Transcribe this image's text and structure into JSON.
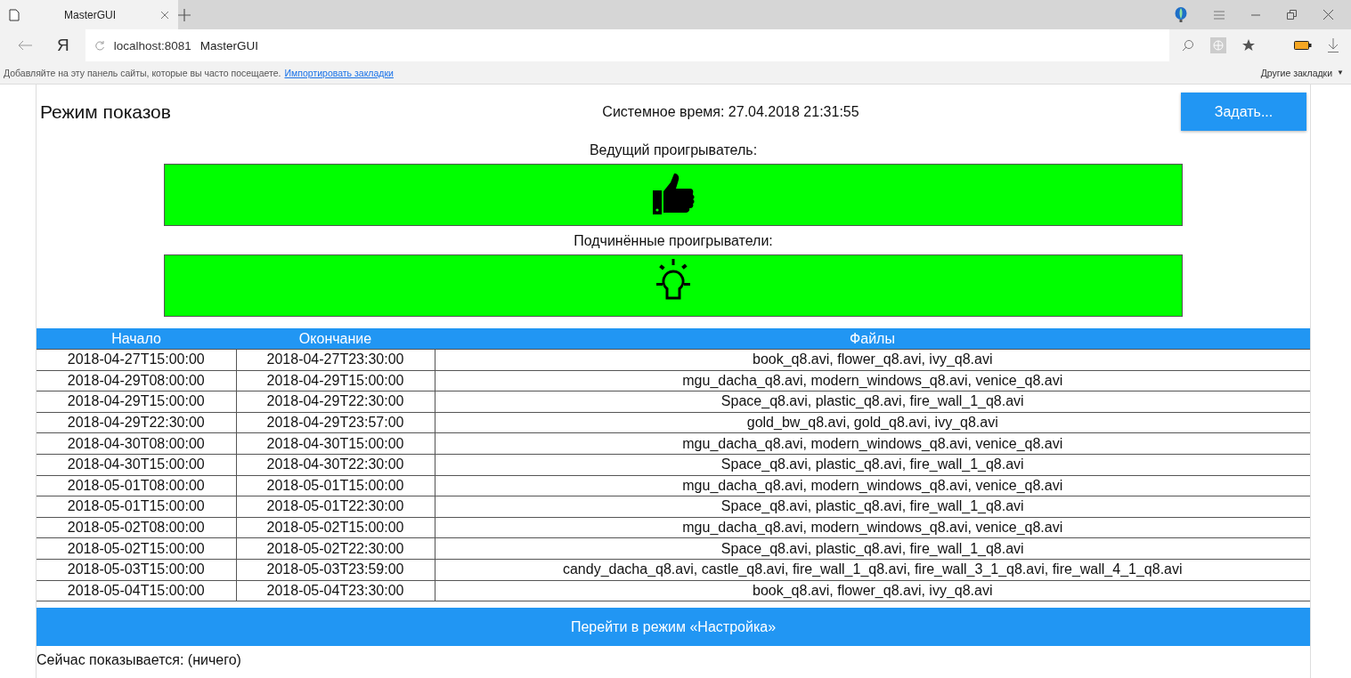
{
  "browser": {
    "tab": {
      "title": "MasterGUI",
      "selected": true
    },
    "logo": "Я",
    "address": {
      "host": "localhost:8081",
      "page_title": "MasterGUI"
    },
    "bookmarks_bar": {
      "hint": "Добавляйте на эту панель сайты, которые вы часто посещаете.",
      "link": "Импортировать закладки",
      "other": "Другие закладки",
      "other_caret": "▼"
    }
  },
  "page": {
    "title": "Режим показов",
    "system_time": "Системное время: 27.04.2018 21:31:55",
    "set_button": "Задать...",
    "players": [
      {
        "label": "Ведущий проигрыватель:",
        "kind": "thumbs-up",
        "color": "#00ff00"
      },
      {
        "label": "Подчинённые проигрыватели:",
        "kind": "bulb",
        "color": "#00ff00"
      }
    ],
    "table": {
      "columns": [
        "Начало",
        "Окончание",
        "Файлы"
      ],
      "rows": [
        [
          "2018-04-27T15:00:00",
          "2018-04-27T23:30:00",
          "book_q8.avi, flower_q8.avi, ivy_q8.avi"
        ],
        [
          "2018-04-29T08:00:00",
          "2018-04-29T15:00:00",
          "mgu_dacha_q8.avi, modern_windows_q8.avi, venice_q8.avi"
        ],
        [
          "2018-04-29T15:00:00",
          "2018-04-29T22:30:00",
          "Space_q8.avi, plastic_q8.avi, fire_wall_1_q8.avi"
        ],
        [
          "2018-04-29T22:30:00",
          "2018-04-29T23:57:00",
          "gold_bw_q8.avi, gold_q8.avi, ivy_q8.avi"
        ],
        [
          "2018-04-30T08:00:00",
          "2018-04-30T15:00:00",
          "mgu_dacha_q8.avi, modern_windows_q8.avi, venice_q8.avi"
        ],
        [
          "2018-04-30T15:00:00",
          "2018-04-30T22:30:00",
          "Space_q8.avi, plastic_q8.avi, fire_wall_1_q8.avi"
        ],
        [
          "2018-05-01T08:00:00",
          "2018-05-01T15:00:00",
          "mgu_dacha_q8.avi, modern_windows_q8.avi, venice_q8.avi"
        ],
        [
          "2018-05-01T15:00:00",
          "2018-05-01T22:30:00",
          "Space_q8.avi, plastic_q8.avi, fire_wall_1_q8.avi"
        ],
        [
          "2018-05-02T08:00:00",
          "2018-05-02T15:00:00",
          "mgu_dacha_q8.avi, modern_windows_q8.avi, venice_q8.avi"
        ],
        [
          "2018-05-02T15:00:00",
          "2018-05-02T22:30:00",
          "Space_q8.avi, plastic_q8.avi, fire_wall_1_q8.avi"
        ],
        [
          "2018-05-03T15:00:00",
          "2018-05-03T23:59:00",
          "candy_dacha_q8.avi, castle_q8.avi, fire_wall_1_q8.avi, fire_wall_3_1_q8.avi, fire_wall_4_1_q8.avi"
        ],
        [
          "2018-05-04T15:00:00",
          "2018-05-04T23:30:00",
          "book_q8.avi, flower_q8.avi, ivy_q8.avi"
        ]
      ]
    },
    "mode_button": "Перейти в режим «Настройка»",
    "now_showing": "Сейчас показывается: (ничего)"
  }
}
